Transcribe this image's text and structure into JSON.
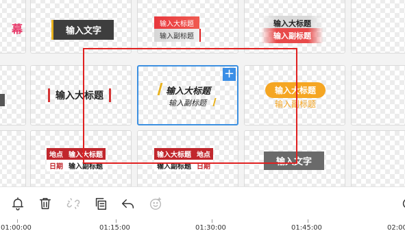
{
  "templates": {
    "row1": {
      "c0_partial": "幕",
      "c1": "输入文字",
      "c2_title": "输入大标题",
      "c2_sub": "输入副标题",
      "c3_title": "输入大标题",
      "c3_sub": "输入副标题"
    },
    "row2": {
      "c1": "输入大标题",
      "c2_title": "输入大标题",
      "c2_sub": "输入副标题",
      "c2_add": "+",
      "c3_title": "输入大标题",
      "c3_sub": "输入副标题"
    },
    "row3": {
      "c1_label1": "地点",
      "c1_title": "输入大标题",
      "c1_label2": "日期",
      "c1_sub": "输入副标题",
      "c2_title": "输入大标题",
      "c2_label1": "地点",
      "c2_sub": "输入副标题",
      "c2_label2": "日期",
      "c3": "输入文字"
    }
  },
  "toolbar": {
    "icons": [
      "bell-icon",
      "trash-icon",
      "unlink-icon",
      "copy-icon",
      "undo-icon",
      "emoji-icon"
    ]
  },
  "timeline": {
    "ticks": [
      "01:00:00",
      "01:15:00",
      "01:30:00",
      "01:45:00",
      "02:00"
    ]
  },
  "colors": {
    "selection": "#e02020",
    "accent_blue": "#3a8ee6",
    "red": "#c1272d",
    "orange": "#f5a623"
  }
}
